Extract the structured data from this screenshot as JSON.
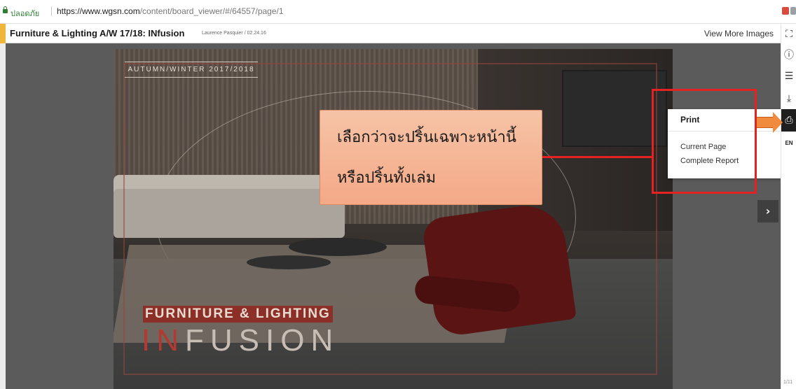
{
  "browser": {
    "secure_label": "ปลอดภัย",
    "url_host": "https://www.wgsn.com",
    "url_path": "/content/board_viewer/#/64557/page/1"
  },
  "header": {
    "title": "Furniture & Lighting A/W 17/18: INfusion",
    "byline": "Laurence Pasquier / 02.24.16",
    "view_more": "View More Images"
  },
  "cover": {
    "season": "AUTUMN/WINTER 2017/2018",
    "banner": "FURNITURE & LIGHTING",
    "word_red": "IN",
    "word_rest": "FUSION"
  },
  "callout": {
    "line1": "เลือกว่าจะปริ้นเฉพาะหน้านี้",
    "line2": "หรือปริ้นทั้งเล่ม"
  },
  "print_menu": {
    "title": "Print",
    "options": [
      "Current Page",
      "Complete Report"
    ]
  },
  "toolbar": {
    "expand_icon": "expand-icon",
    "info_icon": "info-icon",
    "list_icon": "list-icon",
    "download_icon": "download-icon",
    "print_icon": "print-icon",
    "language": "EN",
    "page_count": "1/11"
  },
  "colors": {
    "annotation_red": "#e52222",
    "callout_fill": "#f4a987",
    "accent": "#f0b63b"
  }
}
